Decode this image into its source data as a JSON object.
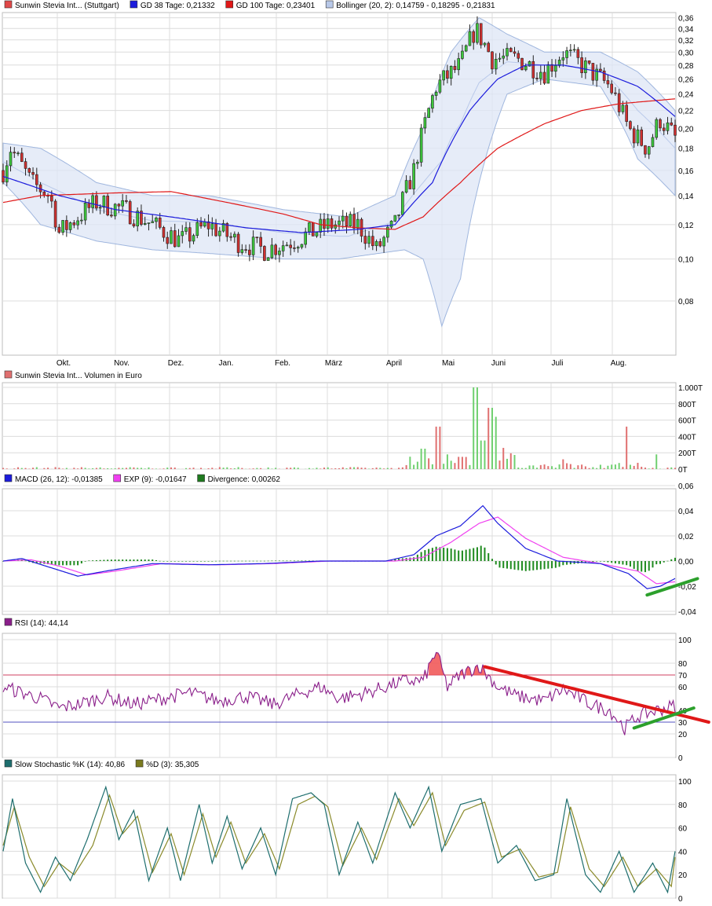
{
  "chart_data": [
    {
      "type": "candlestick",
      "legend": [
        {
          "label": "Sunwin Stevia Int... (Stuttgart)",
          "color": "#e04848"
        },
        {
          "label": "GD 38 Tage: 0,21332",
          "color": "#1c1cdc"
        },
        {
          "label": "GD 100 Tage: 0,23401",
          "color": "#e01818"
        },
        {
          "label": "Bollinger (20, 2): 0,14759 - 0,18295 - 0,21831",
          "color": "#b8c8e8"
        }
      ],
      "y_scale": "log",
      "ylim": [
        0.06,
        0.37
      ],
      "y_ticks": [
        "0,36",
        "0,34",
        "0,32",
        "0,30",
        "0,28",
        "0,26",
        "0,24",
        "0,22",
        "0,20",
        "0,18",
        "0,16",
        "0,14",
        "0,12",
        "0,10",
        "0,08"
      ],
      "months": [
        "Okt.",
        "Nov.",
        "Dez.",
        "Jan.",
        "Feb.",
        "März",
        "April",
        "Mai",
        "Juni",
        "Juli",
        "Aug."
      ],
      "close_anchors": [
        [
          0,
          0.16
        ],
        [
          4,
          0.18
        ],
        [
          15,
          0.15
        ],
        [
          25,
          0.14
        ],
        [
          30,
          0.115
        ],
        [
          50,
          0.135
        ],
        [
          65,
          0.13
        ],
        [
          80,
          0.12
        ],
        [
          95,
          0.11
        ],
        [
          110,
          0.12
        ],
        [
          125,
          0.11
        ],
        [
          140,
          0.105
        ],
        [
          155,
          0.11
        ],
        [
          165,
          0.115
        ],
        [
          175,
          0.12
        ],
        [
          190,
          0.12
        ],
        [
          200,
          0.105
        ],
        [
          210,
          0.12
        ],
        [
          220,
          0.16
        ],
        [
          232,
          0.25
        ],
        [
          245,
          0.28
        ],
        [
          253,
          0.34
        ],
        [
          262,
          0.29
        ],
        [
          275,
          0.29
        ],
        [
          290,
          0.27
        ],
        [
          300,
          0.3
        ],
        [
          315,
          0.27
        ],
        [
          325,
          0.25
        ],
        [
          335,
          0.2
        ],
        [
          345,
          0.18
        ],
        [
          352,
          0.21
        ],
        [
          360,
          0.19
        ]
      ],
      "gd38_anchors": [
        [
          0,
          0.155
        ],
        [
          30,
          0.14
        ],
        [
          60,
          0.13
        ],
        [
          90,
          0.125
        ],
        [
          130,
          0.118
        ],
        [
          160,
          0.115
        ],
        [
          190,
          0.117
        ],
        [
          210,
          0.12
        ],
        [
          230,
          0.15
        ],
        [
          250,
          0.22
        ],
        [
          265,
          0.26
        ],
        [
          280,
          0.28
        ],
        [
          300,
          0.28
        ],
        [
          320,
          0.27
        ],
        [
          340,
          0.25
        ],
        [
          360,
          0.213
        ]
      ],
      "gd100_anchors": [
        [
          0,
          0.135
        ],
        [
          20,
          0.14
        ],
        [
          60,
          0.142
        ],
        [
          90,
          0.143
        ],
        [
          120,
          0.135
        ],
        [
          150,
          0.127
        ],
        [
          170,
          0.12
        ],
        [
          190,
          0.118
        ],
        [
          210,
          0.117
        ],
        [
          225,
          0.125
        ],
        [
          245,
          0.15
        ],
        [
          265,
          0.18
        ],
        [
          290,
          0.205
        ],
        [
          310,
          0.22
        ],
        [
          330,
          0.228
        ],
        [
          360,
          0.234
        ]
      ],
      "boll_upper_anchors": [
        [
          0,
          0.185
        ],
        [
          20,
          0.18
        ],
        [
          50,
          0.15
        ],
        [
          80,
          0.14
        ],
        [
          110,
          0.14
        ],
        [
          150,
          0.13
        ],
        [
          185,
          0.125
        ],
        [
          210,
          0.14
        ],
        [
          225,
          0.2
        ],
        [
          240,
          0.3
        ],
        [
          255,
          0.36
        ],
        [
          270,
          0.33
        ],
        [
          290,
          0.3
        ],
        [
          320,
          0.3
        ],
        [
          340,
          0.27
        ],
        [
          360,
          0.22
        ]
      ],
      "boll_lower_anchors": [
        [
          0,
          0.15
        ],
        [
          20,
          0.12
        ],
        [
          50,
          0.11
        ],
        [
          80,
          0.105
        ],
        [
          110,
          0.103
        ],
        [
          150,
          0.1
        ],
        [
          180,
          0.1
        ],
        [
          215,
          0.105
        ],
        [
          225,
          0.1
        ],
        [
          235,
          0.07
        ],
        [
          245,
          0.09
        ],
        [
          255,
          0.15
        ],
        [
          270,
          0.24
        ],
        [
          290,
          0.26
        ],
        [
          320,
          0.25
        ],
        [
          340,
          0.17
        ],
        [
          360,
          0.14
        ]
      ]
    },
    {
      "type": "bar",
      "legend": [
        {
          "label": "Sunwin Stevia Int... Volumen in Euro",
          "color": "#e07070"
        }
      ],
      "ylim": [
        0,
        1000
      ],
      "y_ticks": [
        "1.000T",
        "800T",
        "600T",
        "400T",
        "200T",
        "0T"
      ],
      "spikes": [
        [
          225,
          250
        ],
        [
          233,
          520
        ],
        [
          238,
          180
        ],
        [
          245,
          150
        ],
        [
          252,
          380
        ],
        [
          253,
          1000
        ],
        [
          257,
          350
        ],
        [
          260,
          720
        ],
        [
          261,
          750
        ],
        [
          264,
          640
        ],
        [
          268,
          260
        ],
        [
          300,
          120
        ],
        [
          334,
          520
        ],
        [
          350,
          180
        ]
      ]
    },
    {
      "type": "line",
      "legend": [
        {
          "label": "MACD (26, 12): -0,01385",
          "color": "#1c1cdc"
        },
        {
          "label": "EXP (9): -0,01647",
          "color": "#f040f0"
        },
        {
          "label": "Divergence: 0,00262",
          "color": "#1e7a1e"
        }
      ],
      "ylim": [
        -0.04,
        0.06
      ],
      "y_ticks": [
        "0,06",
        "0,04",
        "0,02",
        "0,00",
        "-0,02",
        "-0,04"
      ],
      "macd_anchors": [
        [
          0,
          0.0
        ],
        [
          10,
          0.002
        ],
        [
          25,
          -0.005
        ],
        [
          40,
          -0.012
        ],
        [
          55,
          -0.008
        ],
        [
          80,
          -0.002
        ],
        [
          110,
          -0.003
        ],
        [
          140,
          -0.002
        ],
        [
          170,
          0.0
        ],
        [
          205,
          0.0
        ],
        [
          220,
          0.005
        ],
        [
          232,
          0.02
        ],
        [
          245,
          0.028
        ],
        [
          257,
          0.044
        ],
        [
          265,
          0.03
        ],
        [
          280,
          0.01
        ],
        [
          297,
          0.0
        ],
        [
          320,
          -0.002
        ],
        [
          335,
          -0.01
        ],
        [
          345,
          -0.022
        ],
        [
          352,
          -0.02
        ],
        [
          360,
          -0.0139
        ]
      ],
      "exp_anchors": [
        [
          0,
          0.0
        ],
        [
          15,
          0.001
        ],
        [
          30,
          -0.004
        ],
        [
          45,
          -0.011
        ],
        [
          60,
          -0.008
        ],
        [
          85,
          -0.002
        ],
        [
          115,
          -0.003
        ],
        [
          145,
          -0.002
        ],
        [
          175,
          0.0
        ],
        [
          210,
          0.0
        ],
        [
          225,
          0.003
        ],
        [
          240,
          0.015
        ],
        [
          255,
          0.03
        ],
        [
          265,
          0.035
        ],
        [
          280,
          0.018
        ],
        [
          300,
          0.003
        ],
        [
          320,
          -0.002
        ],
        [
          340,
          -0.008
        ],
        [
          350,
          -0.018
        ],
        [
          360,
          -0.0165
        ]
      ],
      "trend_line": {
        "x": [
          345,
          372
        ],
        "y": [
          -0.027,
          -0.014
        ],
        "color": "#2ca02c"
      }
    },
    {
      "type": "line",
      "legend": [
        {
          "label": "RSI (14): 44,14",
          "color": "#8a1e8a"
        }
      ],
      "ylim": [
        0,
        100
      ],
      "y_ticks": [
        "100",
        "80",
        "70",
        "60",
        "40",
        "30",
        "20",
        "0"
      ],
      "levels": [
        70,
        30
      ],
      "rsi_anchors": [
        [
          0,
          60
        ],
        [
          10,
          55
        ],
        [
          20,
          50
        ],
        [
          30,
          42
        ],
        [
          40,
          45
        ],
        [
          55,
          52
        ],
        [
          70,
          45
        ],
        [
          85,
          50
        ],
        [
          100,
          55
        ],
        [
          115,
          48
        ],
        [
          130,
          52
        ],
        [
          145,
          45
        ],
        [
          160,
          55
        ],
        [
          170,
          60
        ],
        [
          180,
          50
        ],
        [
          195,
          55
        ],
        [
          205,
          60
        ],
        [
          215,
          65
        ],
        [
          225,
          65
        ],
        [
          232,
          90
        ],
        [
          238,
          60
        ],
        [
          245,
          70
        ],
        [
          255,
          78
        ],
        [
          265,
          60
        ],
        [
          275,
          52
        ],
        [
          290,
          48
        ],
        [
          300,
          58
        ],
        [
          315,
          45
        ],
        [
          325,
          40
        ],
        [
          333,
          25
        ],
        [
          340,
          35
        ],
        [
          350,
          40
        ],
        [
          360,
          44
        ]
      ],
      "trend_lines": [
        {
          "x": [
            258,
            378
          ],
          "y": [
            77,
            30
          ],
          "color": "#e01818"
        },
        {
          "x": [
            338,
            370
          ],
          "y": [
            25,
            42
          ],
          "color": "#2ca02c"
        }
      ]
    },
    {
      "type": "line",
      "legend": [
        {
          "label": "Slow Stochastic %K (14): 40,86",
          "color": "#1e6e6e"
        },
        {
          "label": "%D (3): 35,305",
          "color": "#7a7a1e"
        }
      ],
      "ylim": [
        0,
        100
      ],
      "y_ticks": [
        "100",
        "80",
        "60",
        "40",
        "20",
        "0"
      ],
      "k_anchors": [
        [
          0,
          40
        ],
        [
          5,
          85
        ],
        [
          12,
          30
        ],
        [
          20,
          5
        ],
        [
          28,
          35
        ],
        [
          36,
          15
        ],
        [
          45,
          50
        ],
        [
          55,
          95
        ],
        [
          62,
          50
        ],
        [
          70,
          75
        ],
        [
          78,
          15
        ],
        [
          88,
          60
        ],
        [
          95,
          15
        ],
        [
          105,
          80
        ],
        [
          112,
          30
        ],
        [
          120,
          70
        ],
        [
          128,
          25
        ],
        [
          138,
          60
        ],
        [
          146,
          20
        ],
        [
          155,
          85
        ],
        [
          165,
          90
        ],
        [
          172,
          80
        ],
        [
          180,
          20
        ],
        [
          190,
          65
        ],
        [
          198,
          30
        ],
        [
          210,
          90
        ],
        [
          218,
          60
        ],
        [
          228,
          95
        ],
        [
          235,
          40
        ],
        [
          245,
          80
        ],
        [
          256,
          85
        ],
        [
          265,
          30
        ],
        [
          275,
          45
        ],
        [
          285,
          15
        ],
        [
          295,
          20
        ],
        [
          302,
          85
        ],
        [
          312,
          20
        ],
        [
          320,
          5
        ],
        [
          330,
          40
        ],
        [
          338,
          5
        ],
        [
          348,
          30
        ],
        [
          356,
          5
        ],
        [
          360,
          40
        ]
      ],
      "d_anchors": [
        [
          0,
          45
        ],
        [
          6,
          78
        ],
        [
          14,
          35
        ],
        [
          22,
          10
        ],
        [
          30,
          30
        ],
        [
          38,
          20
        ],
        [
          48,
          45
        ],
        [
          57,
          88
        ],
        [
          64,
          55
        ],
        [
          72,
          70
        ],
        [
          80,
          22
        ],
        [
          90,
          55
        ],
        [
          97,
          20
        ],
        [
          107,
          72
        ],
        [
          114,
          35
        ],
        [
          122,
          65
        ],
        [
          130,
          30
        ],
        [
          140,
          55
        ],
        [
          148,
          25
        ],
        [
          158,
          80
        ],
        [
          167,
          87
        ],
        [
          174,
          78
        ],
        [
          182,
          28
        ],
        [
          192,
          60
        ],
        [
          200,
          33
        ],
        [
          212,
          85
        ],
        [
          220,
          62
        ],
        [
          230,
          90
        ],
        [
          237,
          45
        ],
        [
          247,
          75
        ],
        [
          258,
          82
        ],
        [
          267,
          35
        ],
        [
          277,
          42
        ],
        [
          287,
          18
        ],
        [
          297,
          22
        ],
        [
          304,
          78
        ],
        [
          314,
          25
        ],
        [
          322,
          10
        ],
        [
          332,
          35
        ],
        [
          340,
          10
        ],
        [
          350,
          25
        ],
        [
          358,
          10
        ],
        [
          360,
          35
        ]
      ]
    }
  ]
}
